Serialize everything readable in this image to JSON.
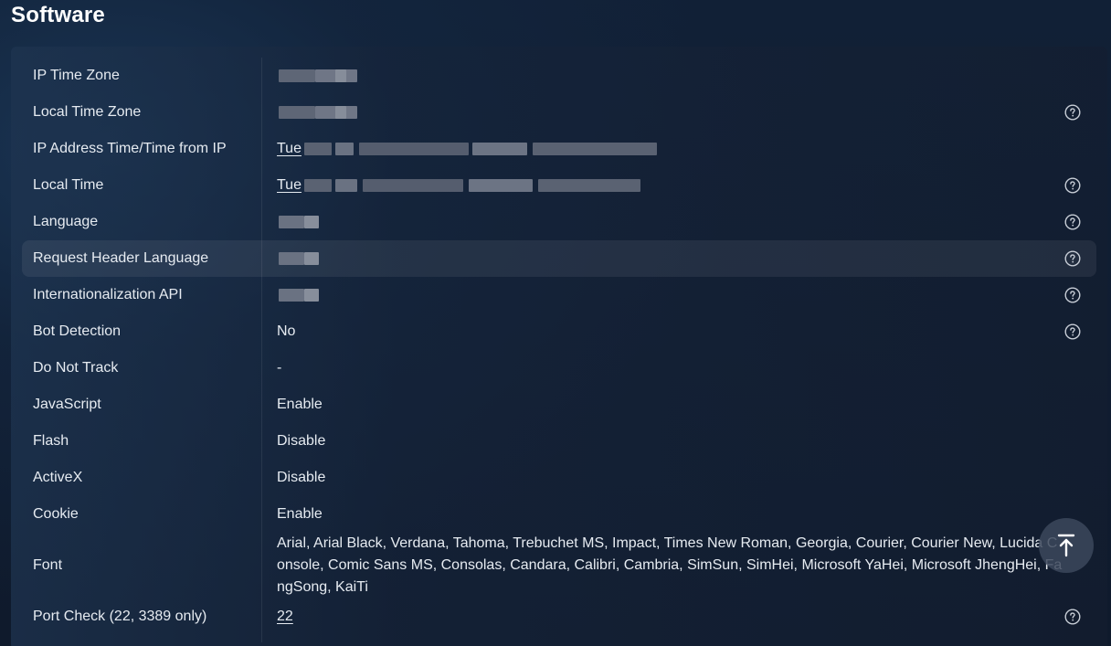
{
  "section": {
    "title": "Software"
  },
  "rows": [
    {
      "label": "IP Time Zone",
      "value": ""
    },
    {
      "label": "Local Time Zone",
      "value": ""
    },
    {
      "label": "IP Address Time/Time from IP",
      "value": "Tue"
    },
    {
      "label": "Local Time",
      "value": "Tue"
    },
    {
      "label": "Language",
      "value": ""
    },
    {
      "label": "Request Header Language",
      "value": ""
    },
    {
      "label": "Internationalization API",
      "value": ""
    },
    {
      "label": "Bot Detection",
      "value": "No"
    },
    {
      "label": "Do Not Track",
      "value": "-"
    },
    {
      "label": "JavaScript",
      "value": "Enable"
    },
    {
      "label": "Flash",
      "value": "Disable"
    },
    {
      "label": "ActiveX",
      "value": "Disable"
    },
    {
      "label": "Cookie",
      "value": "Enable"
    },
    {
      "label": "Font",
      "value": "Arial, Arial Black, Verdana, Tahoma, Trebuchet MS, Impact, Times New Roman, Georgia, Courier, Courier New, Lucida Console, Comic Sans MS, Consolas, Candara, Calibri, Cambria, SimSun, SimHei, Microsoft YaHei, Microsoft JhengHei, FangSong, KaiTi"
    },
    {
      "label": "Port Check (22, 3389 only)",
      "value": "22"
    }
  ],
  "icons": {
    "help": "question-circle-icon",
    "scroll_top": "arrow-up-to-line-icon"
  },
  "colors": {
    "background": "#101a2c",
    "text": "#e6ebf1",
    "title": "#ffffff"
  }
}
